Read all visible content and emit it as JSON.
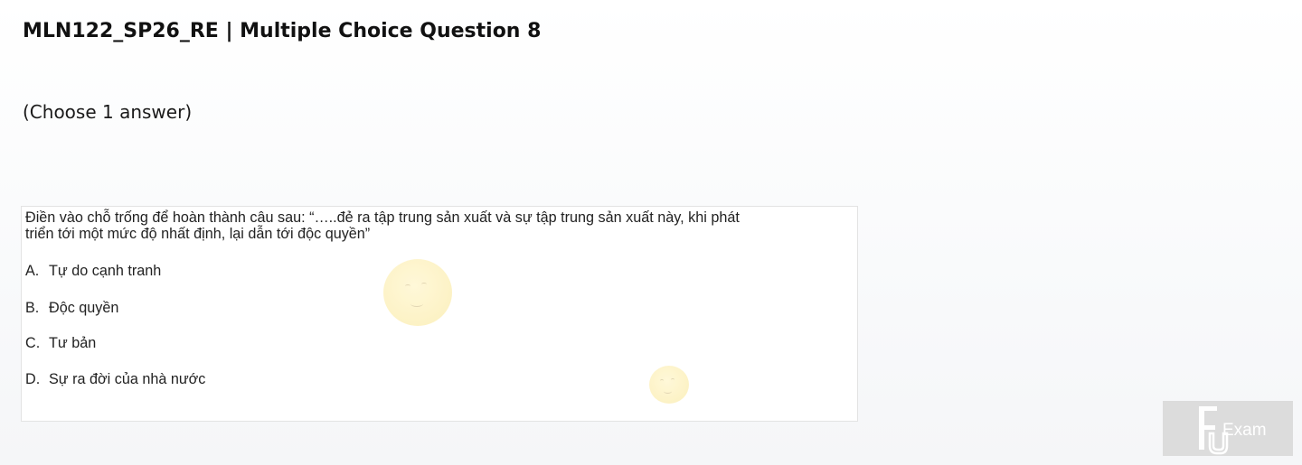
{
  "header": {
    "title": "MLN122_SP26_RE | Multiple Choice Question 8"
  },
  "instruction": "(Choose 1 answer)",
  "question": {
    "line1": "Điền vào chỗ trống để hoàn thành câu sau: “…..đẻ ra tập trung sản xuất và sự tập trung sản xuất này, khi phát",
    "line2": "triển tới một mức độ nhất định, lại dẫn tới độc quyền”",
    "options": [
      {
        "letter": "A.",
        "text": "Tự do cạnh tranh"
      },
      {
        "letter": "B.",
        "text": "Độc quyền"
      },
      {
        "letter": "C.",
        "text": "Tư bản"
      },
      {
        "letter": "D.",
        "text": "Sự ra đời của nhà nước"
      }
    ]
  },
  "logo": {
    "text": "FU Exam",
    "background": "#dcdcdc",
    "foreground": "#ffffff"
  }
}
